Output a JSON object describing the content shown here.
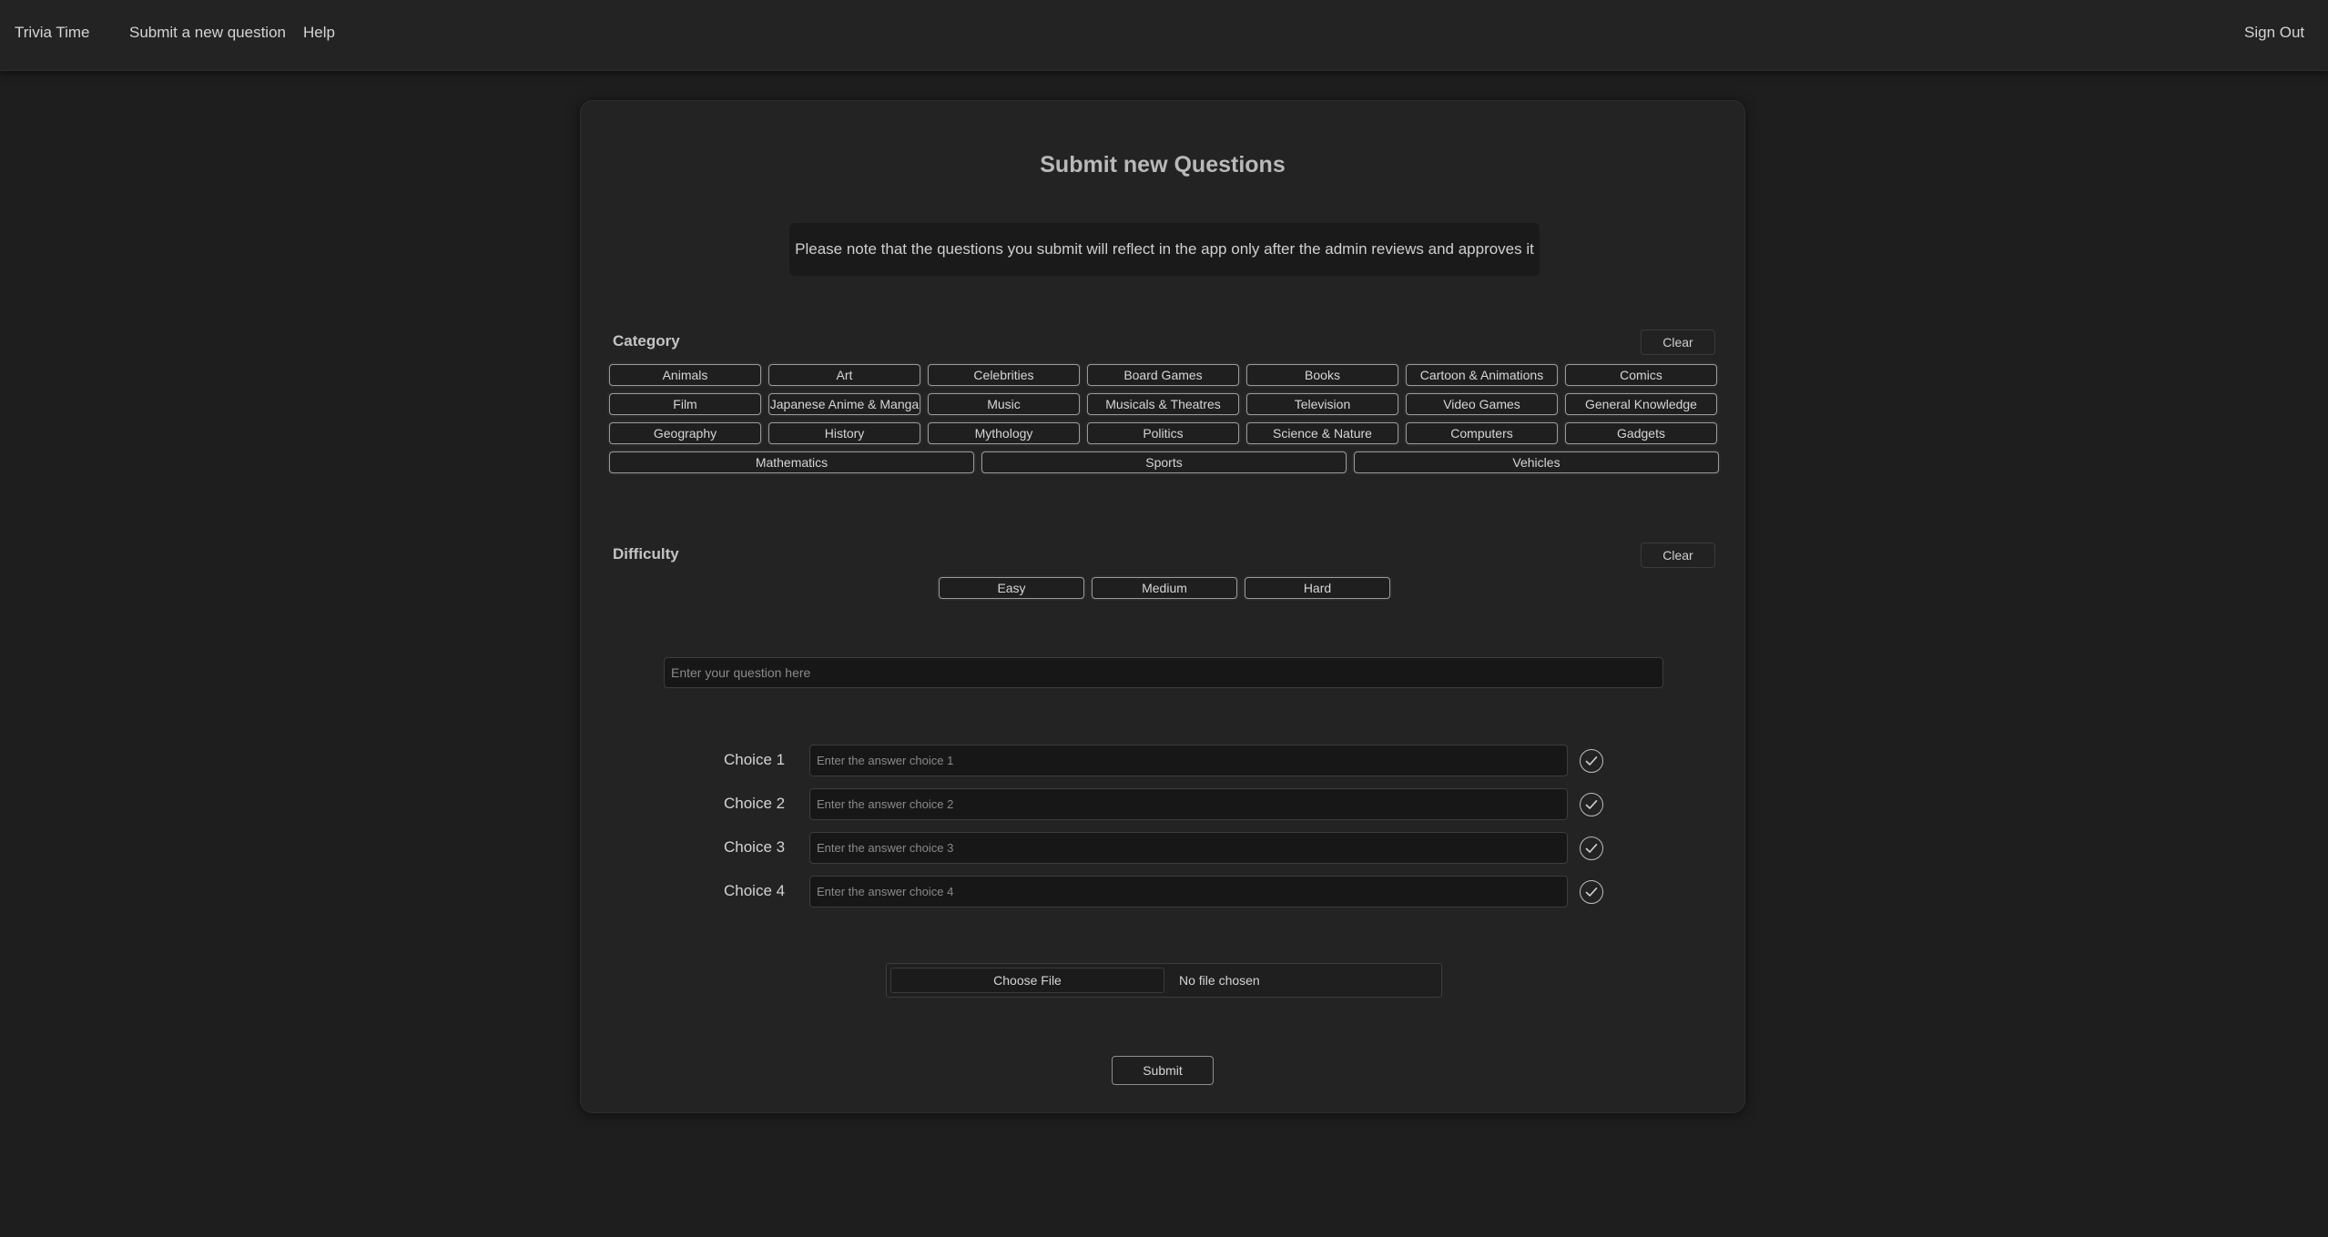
{
  "nav": {
    "brand": "Trivia Time",
    "submit_link": "Submit a new question",
    "help_link": "Help",
    "sign_out": "Sign Out"
  },
  "form": {
    "title": "Submit new Questions",
    "notice": "Please note that the questions you submit will reflect in the app only after the admin reviews and approves it",
    "category": {
      "label": "Category",
      "clear_label": "Clear",
      "options": [
        "Animals",
        "Art",
        "Celebrities",
        "Board Games",
        "Books",
        "Cartoon & Animations",
        "Comics",
        "Film",
        "Japanese Anime & Manga",
        "Music",
        "Musicals & Theatres",
        "Television",
        "Video Games",
        "General Knowledge",
        "Geography",
        "History",
        "Mythology",
        "Politics",
        "Science & Nature",
        "Computers",
        "Gadgets",
        "Mathematics",
        "Sports",
        "Vehicles"
      ]
    },
    "difficulty": {
      "label": "Difficulty",
      "clear_label": "Clear",
      "options": [
        "Easy",
        "Medium",
        "Hard"
      ]
    },
    "question": {
      "placeholder": "Enter your question here",
      "value": ""
    },
    "choices": [
      {
        "label": "Choice 1",
        "placeholder": "Enter the answer choice 1",
        "value": ""
      },
      {
        "label": "Choice 2",
        "placeholder": "Enter the answer choice 2",
        "value": ""
      },
      {
        "label": "Choice 3",
        "placeholder": "Enter the answer choice 3",
        "value": ""
      },
      {
        "label": "Choice 4",
        "placeholder": "Enter the answer choice 4",
        "value": ""
      }
    ],
    "choice_check_icon": "check-circle-icon",
    "file": {
      "button_label": "Choose File",
      "status": "No file chosen"
    },
    "submit_label": "Submit"
  }
}
